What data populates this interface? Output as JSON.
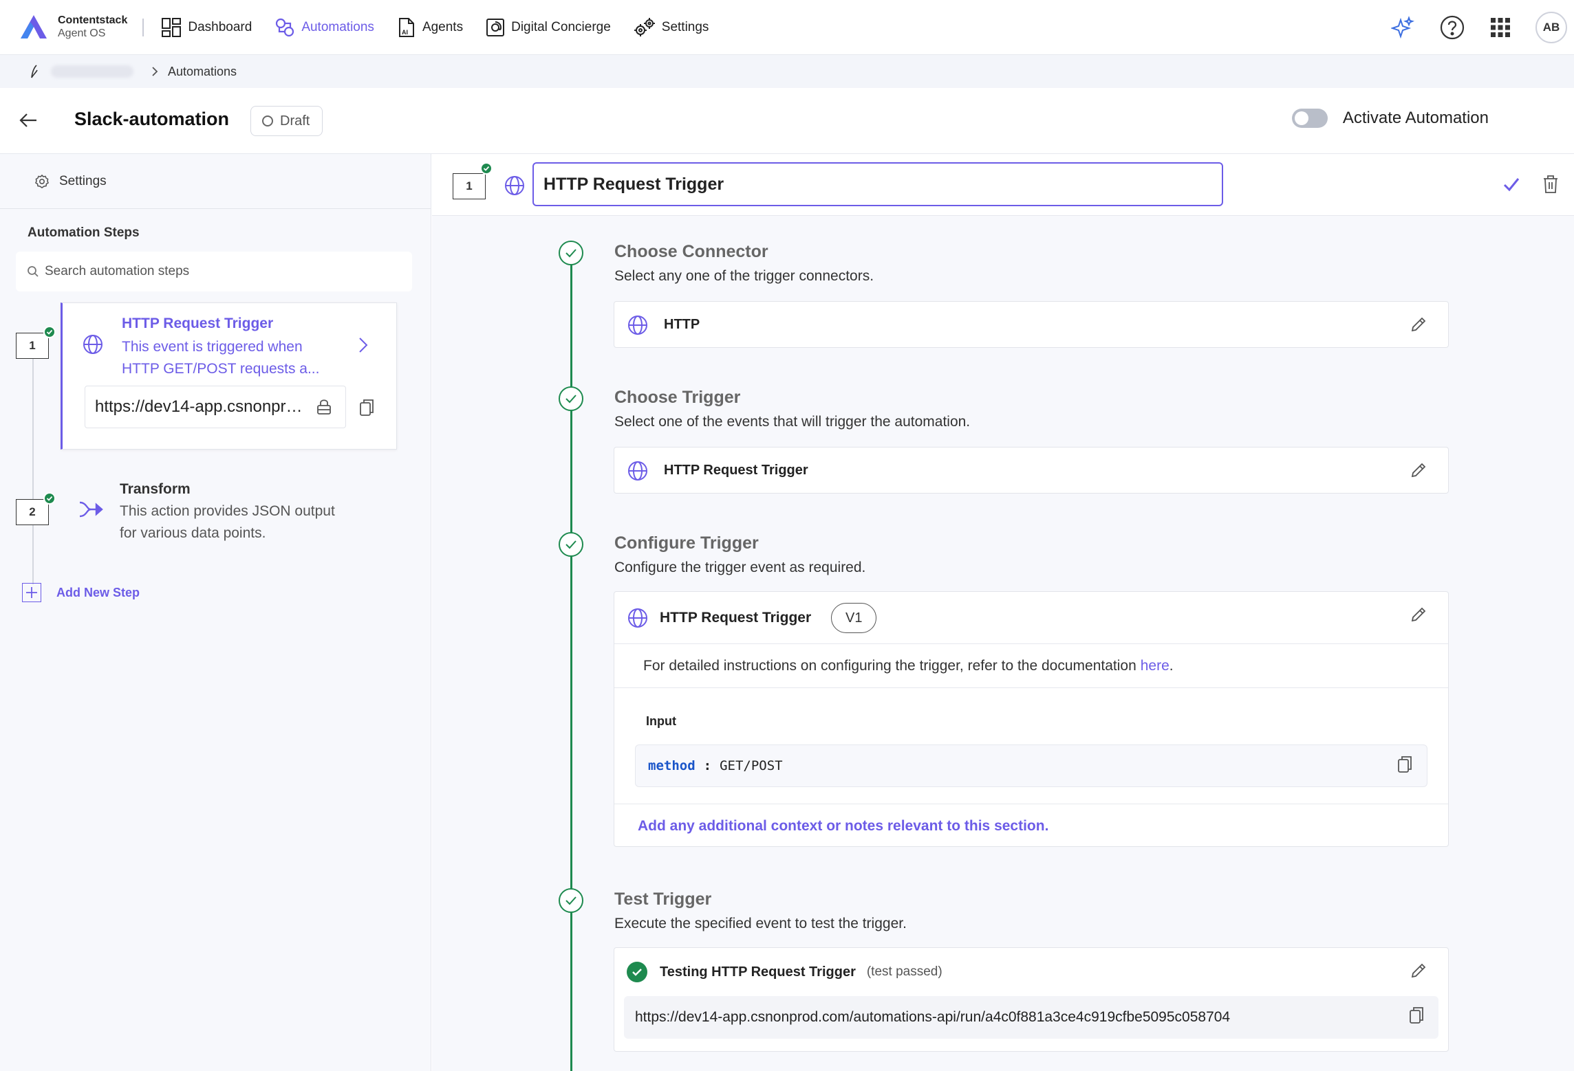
{
  "brand": {
    "name": "Contentstack",
    "sub": "Agent OS"
  },
  "nav": {
    "items": [
      {
        "label": "Dashboard",
        "icon": "dashboard-icon"
      },
      {
        "label": "Automations",
        "icon": "automations-icon",
        "active": true
      },
      {
        "label": "Agents",
        "icon": "agents-icon"
      },
      {
        "label": "Digital Concierge",
        "icon": "concierge-icon"
      },
      {
        "label": "Settings",
        "icon": "gears-icon"
      }
    ],
    "avatar": "AB"
  },
  "breadcrumb": {
    "current": "Automations"
  },
  "header": {
    "title": "Slack-automation",
    "status": "Draft",
    "activate_label": "Activate Automation",
    "activate_on": false
  },
  "sidebar": {
    "settings_label": "Settings",
    "steps_title": "Automation Steps",
    "search_placeholder": "Search automation steps",
    "steps": [
      {
        "number": "1",
        "title": "HTTP Request Trigger",
        "description": "This event is triggered when HTTP GET/POST requests a...",
        "url": "https://dev14-app.csnonprod.com/automations-api/run/a4c0f881a3ce4c919cfbe5095c058704"
      },
      {
        "number": "2",
        "title": "Transform",
        "description": "This action provides JSON output for various data points."
      }
    ],
    "add_step_label": "Add New Step"
  },
  "main": {
    "step_number": "1",
    "step_name": "HTTP Request Trigger",
    "sections": {
      "connector": {
        "title": "Choose Connector",
        "description": "Select any one of the trigger connectors.",
        "value": "HTTP"
      },
      "trigger": {
        "title": "Choose Trigger",
        "description": "Select one of the events that will trigger the automation.",
        "value": "HTTP Request Trigger"
      },
      "configure": {
        "title": "Configure Trigger",
        "description": "Configure the trigger event as required.",
        "header": "HTTP Request Trigger",
        "version": "V1",
        "doc_text": "For detailed instructions on configuring the trigger, refer to the documentation",
        "doc_link": "here",
        "doc_suffix": ".",
        "input_label": "Input",
        "input_key": "method",
        "input_sep": ":",
        "input_value": "GET/POST",
        "notes": "Add any additional context or notes relevant to this section."
      },
      "test": {
        "title": "Test Trigger",
        "description": "Execute the specified event to test the trigger.",
        "header": "Testing HTTP Request Trigger",
        "status": "(test passed)",
        "url": "https://dev14-app.csnonprod.com/automations-api/run/a4c0f881a3ce4c919cfbe5095c058704"
      }
    }
  },
  "colors": {
    "accent": "#6c5ce7",
    "success": "#1e8a4f",
    "code_key": "#1a55c9"
  }
}
